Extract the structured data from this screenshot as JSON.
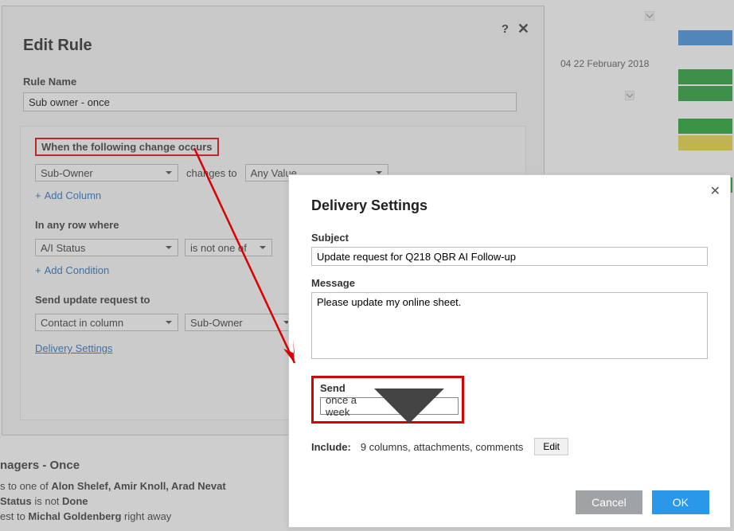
{
  "editRule": {
    "title": "Edit Rule",
    "ruleNameLabel": "Rule Name",
    "ruleNameValue": "Sub owner - once",
    "whenChangeLabel": "When the following change occurs",
    "whenColumn": "Sub-Owner",
    "changesTo": "changes to",
    "anyValue": "Any Value",
    "addColumn": "Add Column",
    "inAnyRowLabel": "In any row where",
    "rowColumn": "A/I Status",
    "rowOperator": "is not one of",
    "addCondition": "Add Condition",
    "sendRequestLabel": "Send update request to",
    "sendTarget": "Contact in column",
    "sendColumn": "Sub-Owner",
    "deliverySettingsLink": "Delivery Settings"
  },
  "background": {
    "timestamp": "04 22 February 2018"
  },
  "bottom": {
    "title": "nagers - Once",
    "line1_prefix": "s to one of ",
    "line1_names": "Alon Shelef, Amir Knoll, Arad Nevat",
    "line2_prefix": "Status",
    "line2_mid": " is not ",
    "line2_val": "Done",
    "line3_prefix": "est to ",
    "line3_name": "Michal Goldenberg",
    "line3_suffix": " right away"
  },
  "delivery": {
    "title": "Delivery Settings",
    "subjectLabel": "Subject",
    "subjectValue": "Update request for Q218 QBR AI Follow-up",
    "messageLabel": "Message",
    "messageValue": "Please update my online sheet.",
    "sendLabel": "Send",
    "sendValue": "once a week",
    "includeLabel": "Include:",
    "includeText": "9 columns, attachments, comments",
    "editBtn": "Edit",
    "cancelBtn": "Cancel",
    "okBtn": "OK"
  }
}
